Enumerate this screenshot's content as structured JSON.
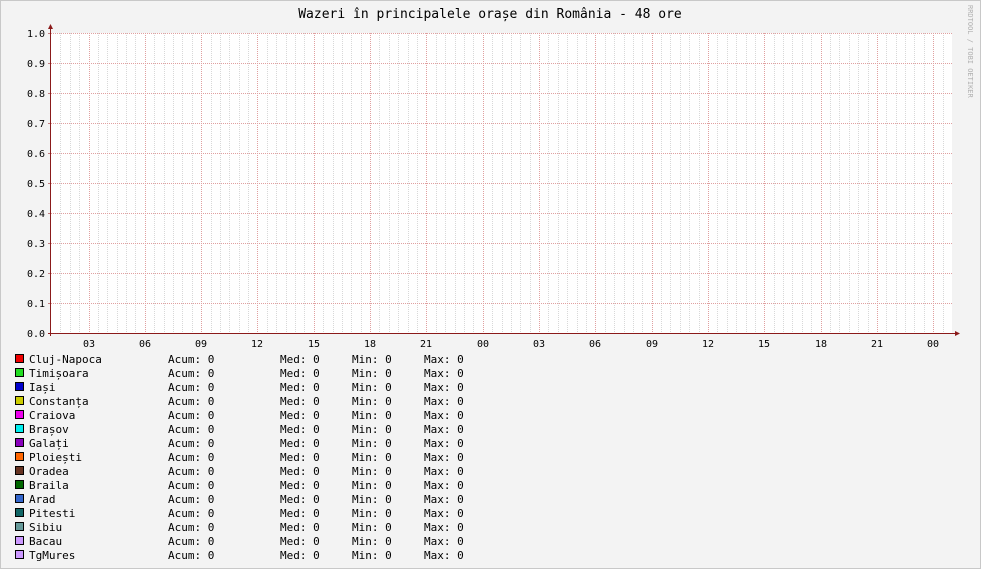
{
  "chart_data": {
    "type": "line",
    "title": "Wazeri în principalele orașe din România - 48 ore",
    "watermark": "RRDTOOL / TOBI OETIKER",
    "xlabel": "",
    "ylabel": "",
    "ylim": [
      0,
      1.0
    ],
    "y_ticks": [
      "0.0",
      "0.1",
      "0.2",
      "0.3",
      "0.4",
      "0.5",
      "0.6",
      "0.7",
      "0.8",
      "0.9",
      "1.0"
    ],
    "x_range_hours": [
      0,
      48
    ],
    "x_ticks": [
      {
        "hour": 2,
        "label": "03"
      },
      {
        "hour": 5,
        "label": "06"
      },
      {
        "hour": 8,
        "label": "09"
      },
      {
        "hour": 11,
        "label": "12"
      },
      {
        "hour": 14,
        "label": "15"
      },
      {
        "hour": 17,
        "label": "18"
      },
      {
        "hour": 20,
        "label": "21"
      },
      {
        "hour": 23,
        "label": "00"
      },
      {
        "hour": 26,
        "label": "03"
      },
      {
        "hour": 29,
        "label": "06"
      },
      {
        "hour": 32,
        "label": "09"
      },
      {
        "hour": 35,
        "label": "12"
      },
      {
        "hour": 38,
        "label": "15"
      },
      {
        "hour": 41,
        "label": "18"
      },
      {
        "hour": 44,
        "label": "21"
      },
      {
        "hour": 47,
        "label": "00"
      }
    ],
    "grid": true,
    "legend_position": "bottom-left",
    "legend_fields": {
      "cur": "Acum:",
      "avg": "Med:",
      "min": "Min:",
      "max": "Max:"
    },
    "series": [
      {
        "name": "Cluj-Napoca",
        "color": "#ee0000",
        "cur": "0",
        "avg": "0",
        "min": "0",
        "max": "0",
        "values": []
      },
      {
        "name": "Timișoara",
        "color": "#22dd22",
        "cur": "0",
        "avg": "0",
        "min": "0",
        "max": "0",
        "values": []
      },
      {
        "name": "Iași",
        "color": "#0000cc",
        "cur": "0",
        "avg": "0",
        "min": "0",
        "max": "0",
        "values": []
      },
      {
        "name": "Constanța",
        "color": "#cccc00",
        "cur": "0",
        "avg": "0",
        "min": "0",
        "max": "0",
        "values": []
      },
      {
        "name": "Craiova",
        "color": "#ee00ee",
        "cur": "0",
        "avg": "0",
        "min": "0",
        "max": "0",
        "values": []
      },
      {
        "name": "Brașov",
        "color": "#00eeee",
        "cur": "0",
        "avg": "0",
        "min": "0",
        "max": "0",
        "values": []
      },
      {
        "name": "Galați",
        "color": "#8800bb",
        "cur": "0",
        "avg": "0",
        "min": "0",
        "max": "0",
        "values": []
      },
      {
        "name": "Ploiești",
        "color": "#ff6600",
        "cur": "0",
        "avg": "0",
        "min": "0",
        "max": "0",
        "values": []
      },
      {
        "name": "Oradea",
        "color": "#663322",
        "cur": "0",
        "avg": "0",
        "min": "0",
        "max": "0",
        "values": []
      },
      {
        "name": "Braila",
        "color": "#006600",
        "cur": "0",
        "avg": "0",
        "min": "0",
        "max": "0",
        "values": []
      },
      {
        "name": "Arad",
        "color": "#3366cc",
        "cur": "0",
        "avg": "0",
        "min": "0",
        "max": "0",
        "values": []
      },
      {
        "name": "Pitesti",
        "color": "#116666",
        "cur": "0",
        "avg": "0",
        "min": "0",
        "max": "0",
        "values": []
      },
      {
        "name": "Sibiu",
        "color": "#669999",
        "cur": "0",
        "avg": "0",
        "min": "0",
        "max": "0",
        "values": []
      },
      {
        "name": "Bacau",
        "color": "#cc99ff",
        "cur": "0",
        "avg": "0",
        "min": "0",
        "max": "0",
        "values": []
      },
      {
        "name": "TgMures",
        "color": "#cc99ff",
        "cur": "0",
        "avg": "0",
        "min": "0",
        "max": "0",
        "values": []
      }
    ]
  }
}
